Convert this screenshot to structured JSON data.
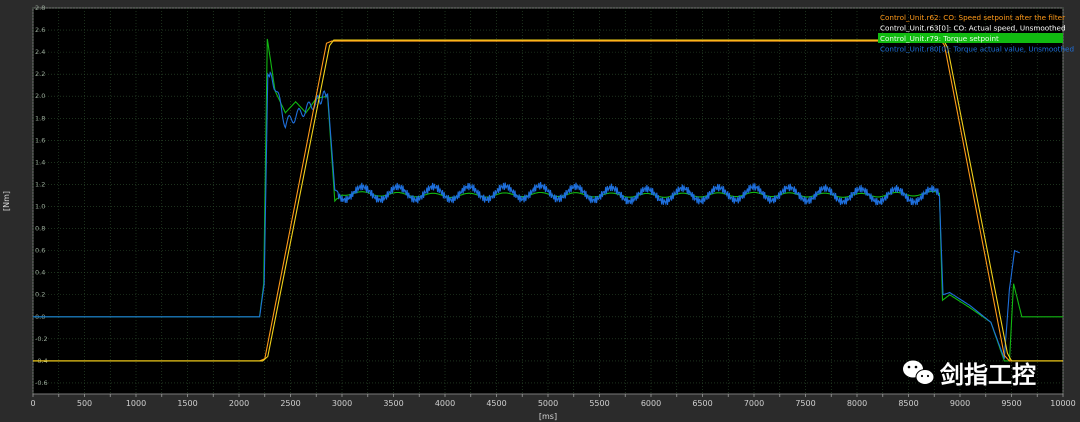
{
  "chart_data": {
    "type": "line",
    "xlabel": "[ms]",
    "ylabel": "[Nm]",
    "xlim": [
      0,
      10000
    ],
    "ylim": [
      -0.7,
      2.8
    ],
    "grid": true,
    "x_ticks": [
      "0",
      "250",
      "500",
      "750",
      "1000",
      "1250",
      "1500",
      "1750",
      "2000",
      "2250",
      "2500",
      "2750",
      "3000",
      "3250",
      "3500",
      "3750",
      "4000",
      "4250",
      "4500",
      "4750",
      "5000",
      "5250",
      "5500",
      "5750",
      "6000",
      "6250",
      "6500",
      "6750",
      "7000",
      "7250",
      "7500",
      "7750",
      "8000",
      "8250",
      "8500",
      "8750",
      "9000",
      "9250",
      "9500",
      "9750",
      "10000"
    ],
    "x_major_labels": [
      "0",
      "500",
      "1000",
      "1500",
      "2000",
      "2500",
      "3000",
      "3500",
      "4000",
      "4500",
      "5000",
      "5500",
      "6000",
      "6500",
      "7000",
      "7500",
      "8000",
      "8500",
      "9000",
      "9500",
      "10000"
    ],
    "y_ticks": [
      "2.8",
      "2.6",
      "2.4",
      "2.2",
      "2.0",
      "1.8",
      "1.6",
      "1.4",
      "1.2",
      "1.0",
      "0.8",
      "0.6",
      "0.4",
      "0.2",
      "0.0",
      "-0.2",
      "-0.4",
      "-0.6"
    ],
    "legend_position": "top-right",
    "series": [
      {
        "name": "Control_Unit.r62: CO: Speed setpoint after the filter",
        "color": "#ff9a1a",
        "x": [
          0,
          2200,
          2250,
          2850,
          2900,
          8820,
          8850,
          9430,
          9480,
          10000
        ],
        "y": [
          -0.4,
          -0.4,
          -0.38,
          2.48,
          2.5,
          2.5,
          2.46,
          -0.35,
          -0.4,
          -0.4
        ]
      },
      {
        "name": "Control_Unit.r63[0]: CO: Actual speed, Unsmoothed",
        "color": "#f2d21a",
        "x": [
          0,
          2230,
          2280,
          2880,
          2920,
          8840,
          8880,
          9460,
          9500,
          10000
        ],
        "y": [
          -0.4,
          -0.4,
          -0.36,
          2.46,
          2.51,
          2.51,
          2.44,
          -0.33,
          -0.4,
          -0.4
        ]
      },
      {
        "name": "Control_Unit.r79: Torque setpoint",
        "color": "#12b812",
        "x": [
          0,
          2200,
          2240,
          2275,
          2350,
          2450,
          2550,
          2650,
          2750,
          2860,
          2930,
          3000,
          4000,
          5000,
          6000,
          7000,
          8000,
          8800,
          8830,
          8900,
          9100,
          9300,
          9430,
          9480,
          9520,
          9600,
          10000
        ],
        "y": [
          0.0,
          0.0,
          0.3,
          2.52,
          2.05,
          1.85,
          1.95,
          1.85,
          1.98,
          2.0,
          1.05,
          1.12,
          1.1,
          1.11,
          1.1,
          1.11,
          1.1,
          1.12,
          0.15,
          0.2,
          0.08,
          -0.05,
          -0.4,
          -0.4,
          0.3,
          0.0,
          0.0
        ]
      },
      {
        "name": "Control_Unit.r80[0]: Torque actual value, Unsmoothed",
        "color": "#1e6fdc",
        "x": [
          0,
          2200,
          2245,
          2280,
          2350,
          2450,
          2550,
          2650,
          2750,
          2860,
          2930,
          3000,
          4000,
          5000,
          6000,
          7000,
          8000,
          8800,
          8835,
          8900,
          9100,
          9300,
          9430,
          9480,
          9530,
          9580
        ],
        "y": [
          0.0,
          0.0,
          0.3,
          2.2,
          2.1,
          1.75,
          1.82,
          1.88,
          1.95,
          2.02,
          1.15,
          1.12,
          1.12,
          1.13,
          1.1,
          1.12,
          1.1,
          1.1,
          0.2,
          0.22,
          0.1,
          -0.05,
          -0.38,
          0.25,
          0.6,
          0.58
        ]
      }
    ]
  },
  "watermark": {
    "text": "剑指工控",
    "icon": "wechat-icon"
  }
}
